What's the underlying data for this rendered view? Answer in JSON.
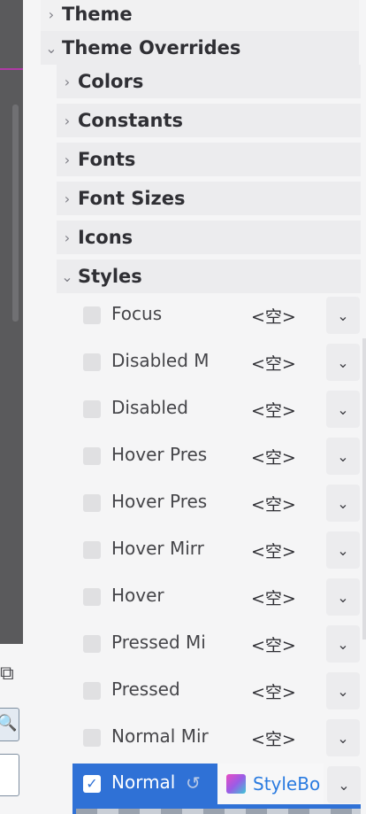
{
  "groups": {
    "theme": "Theme",
    "theme_overrides": "Theme Overrides",
    "colors": "Colors",
    "constants": "Constants",
    "fonts": "Fonts",
    "font_sizes": "Font Sizes",
    "icons": "Icons",
    "styles": "Styles"
  },
  "arrows": {
    "collapsed": "›",
    "expanded": "⌄"
  },
  "styles": [
    {
      "label": "Focus",
      "value": "<空>"
    },
    {
      "label": "Disabled M",
      "value": "<空>"
    },
    {
      "label": "Disabled",
      "value": "<空>"
    },
    {
      "label": "Hover Pres",
      "value": "<空>"
    },
    {
      "label": "Hover Pres",
      "value": "<空>"
    },
    {
      "label": "Hover Mirr",
      "value": "<空>"
    },
    {
      "label": "Hover",
      "value": "<空>"
    },
    {
      "label": "Pressed Mi",
      "value": "<空>"
    },
    {
      "label": "Pressed",
      "value": "<空>"
    },
    {
      "label": "Normal Mir",
      "value": "<空>"
    }
  ],
  "normal": {
    "label": "Normal",
    "checked": true,
    "resource": "StyleBo"
  },
  "colors": {
    "accent": "#2f71d6",
    "resource_text": "#2a7be0",
    "panel": "#f5f5f6"
  }
}
